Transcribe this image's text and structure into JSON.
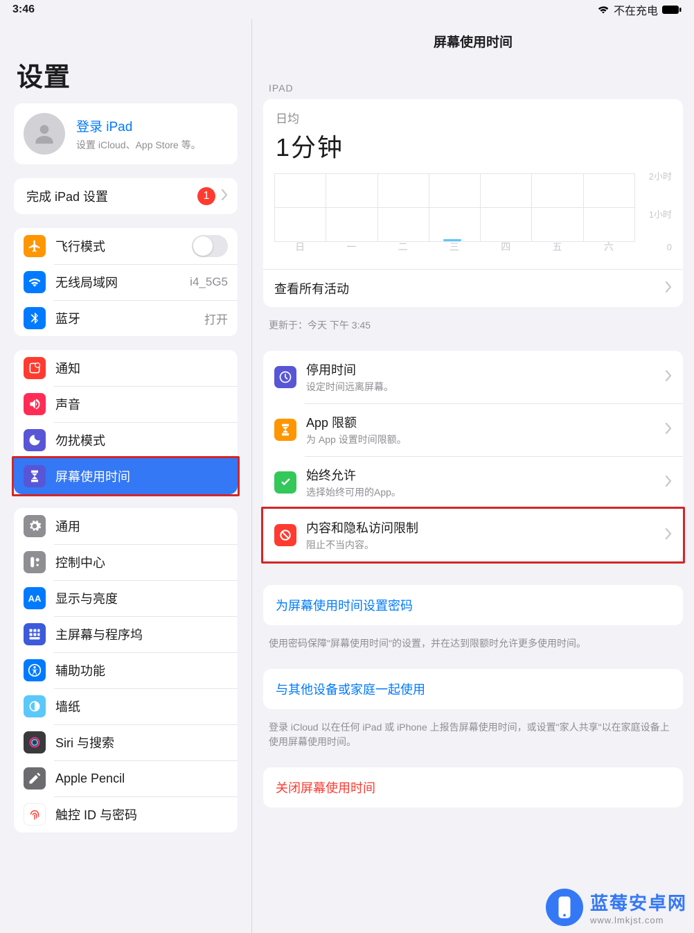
{
  "status": {
    "time": "3:46",
    "charging": "不在充电"
  },
  "sidebar": {
    "title": "设置",
    "signin": {
      "title": "登录 iPad",
      "subtitle": "设置 iCloud、App Store 等。"
    },
    "complete": {
      "label": "完成 iPad 设置",
      "badge": "1"
    },
    "net": {
      "airplane": "飞行模式",
      "wifi": "无线局域网",
      "wifi_val": "i4_5G5",
      "bt": "蓝牙",
      "bt_val": "打开"
    },
    "g2": {
      "notif": "通知",
      "sound": "声音",
      "dnd": "勿扰模式",
      "screentime": "屏幕使用时间"
    },
    "g3": {
      "general": "通用",
      "control": "控制中心",
      "display": "显示与亮度",
      "home": "主屏幕与程序坞",
      "access": "辅助功能",
      "wall": "墙纸",
      "siri": "Siri 与搜索",
      "pencil": "Apple Pencil",
      "touchid": "触控 ID 与密码"
    }
  },
  "detail": {
    "title": "屏幕使用时间",
    "section": "IPAD",
    "usage": {
      "caption": "日均",
      "value": "1分钟"
    },
    "chart": {
      "y": [
        "2小时",
        "1小时",
        "0"
      ],
      "days": [
        "日",
        "一",
        "二",
        "三",
        "四",
        "五",
        "六"
      ]
    },
    "see_all": "查看所有活动",
    "updated": "更新于：今天 下午 3:45",
    "opts": {
      "downtime": {
        "t1": "停用时间",
        "t2": "设定时间远离屏幕。"
      },
      "applimit": {
        "t1": "App 限额",
        "t2": "为 App 设置时间限额。"
      },
      "always": {
        "t1": "始终允许",
        "t2": "选择始终可用的App。"
      },
      "content": {
        "t1": "内容和隐私访问限制",
        "t2": "阻止不当内容。"
      }
    },
    "passcode": "为屏幕使用时间设置密码",
    "passcode_note": "使用密码保障\"屏幕使用时间\"的设置，并在达到限额时允许更多使用时间。",
    "share": "与其他设备或家庭一起使用",
    "share_note": "登录 iCloud 以在任何 iPad 或 iPhone 上报告屏幕使用时间，或设置\"家人共享\"以在家庭设备上使用屏幕使用时间。",
    "turnoff": "关闭屏幕使用时间"
  },
  "chart_data": {
    "type": "bar",
    "categories": [
      "日",
      "一",
      "二",
      "三",
      "四",
      "五",
      "六"
    ],
    "values": [
      0,
      0,
      0,
      1,
      0,
      0,
      0
    ],
    "title": "日均 1分钟",
    "xlabel": "",
    "ylabel": "小时",
    "ylim": [
      0,
      2
    ],
    "y_ticks": [
      0,
      1,
      2
    ],
    "y_tick_labels": [
      "0",
      "1小时",
      "2小时"
    ],
    "unit": "分钟"
  },
  "watermark": {
    "name": "蓝莓安卓网",
    "url": "www.lmkjst.com"
  }
}
